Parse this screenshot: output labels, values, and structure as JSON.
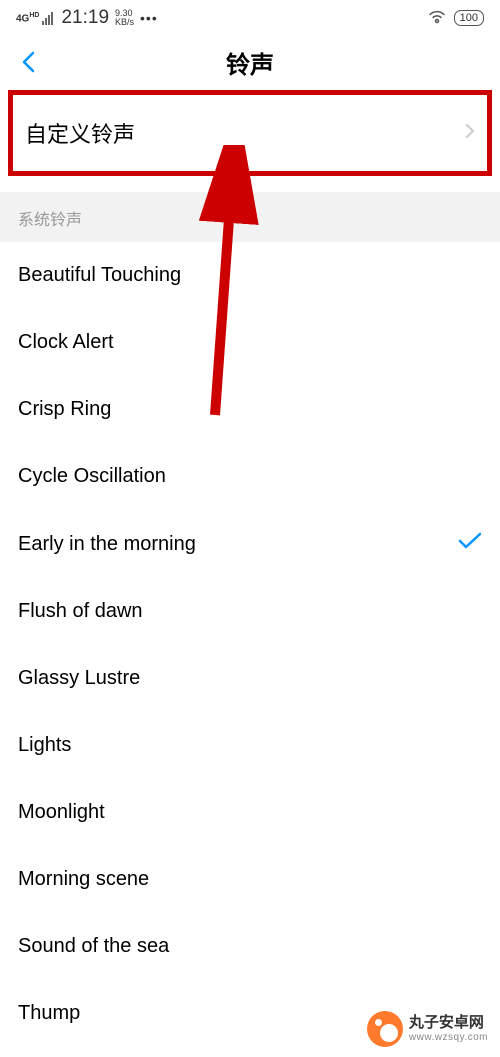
{
  "statusBar": {
    "network": "4G",
    "networkHd": "HD",
    "time": "21:19",
    "speedTop": "9.30",
    "speedBottom": "KB/s",
    "battery": "100"
  },
  "header": {
    "title": "铃声"
  },
  "customRingtone": {
    "label": "自定义铃声"
  },
  "sectionHeader": "系统铃声",
  "ringtones": [
    {
      "label": "Beautiful Touching",
      "selected": false
    },
    {
      "label": "Clock Alert",
      "selected": false
    },
    {
      "label": "Crisp Ring",
      "selected": false
    },
    {
      "label": "Cycle Oscillation",
      "selected": false
    },
    {
      "label": "Early in the morning",
      "selected": true
    },
    {
      "label": "Flush of dawn",
      "selected": false
    },
    {
      "label": "Glassy Lustre",
      "selected": false
    },
    {
      "label": "Lights",
      "selected": false
    },
    {
      "label": "Moonlight",
      "selected": false
    },
    {
      "label": "Morning scene",
      "selected": false
    },
    {
      "label": "Sound of the sea",
      "selected": false
    },
    {
      "label": "Thump",
      "selected": false
    }
  ],
  "watermark": {
    "title": "丸子安卓网",
    "url": "www.wzsqy.com"
  }
}
